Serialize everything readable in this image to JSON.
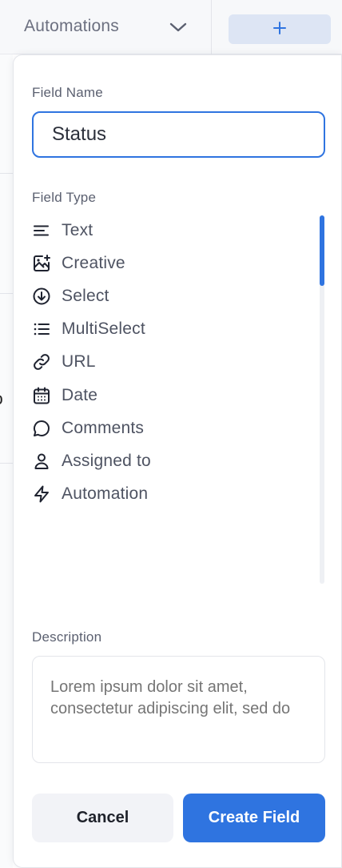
{
  "header": {
    "column_label": "Automations",
    "column_chevron_icon": "chevron-down-icon",
    "add_column_icon": "plus-icon",
    "partial_left_text": "o"
  },
  "panel": {
    "field_name_label": "Field Name",
    "field_name_value": "Status",
    "field_type_label": "Field Type",
    "field_types": [
      {
        "label": "Text",
        "icon": "text-lines-icon"
      },
      {
        "label": "Creative",
        "icon": "image-plus-icon"
      },
      {
        "label": "Select",
        "icon": "circle-arrow-down-icon"
      },
      {
        "label": "MultiSelect",
        "icon": "list-icon"
      },
      {
        "label": "URL",
        "icon": "link-icon"
      },
      {
        "label": "Date",
        "icon": "calendar-icon"
      },
      {
        "label": "Comments",
        "icon": "comment-icon"
      },
      {
        "label": "Assigned to",
        "icon": "user-icon"
      },
      {
        "label": "Automation",
        "icon": "lightning-icon"
      }
    ],
    "description_label": "Description",
    "description_placeholder": "Lorem ipsum dolor sit amet, consectetur adipiscing elit, sed do",
    "cancel_label": "Cancel",
    "create_label": "Create Field"
  },
  "colors": {
    "accent": "#2f74e0",
    "text": "#4e5362",
    "muted": "#5b6070",
    "border": "#e3e5ea"
  }
}
